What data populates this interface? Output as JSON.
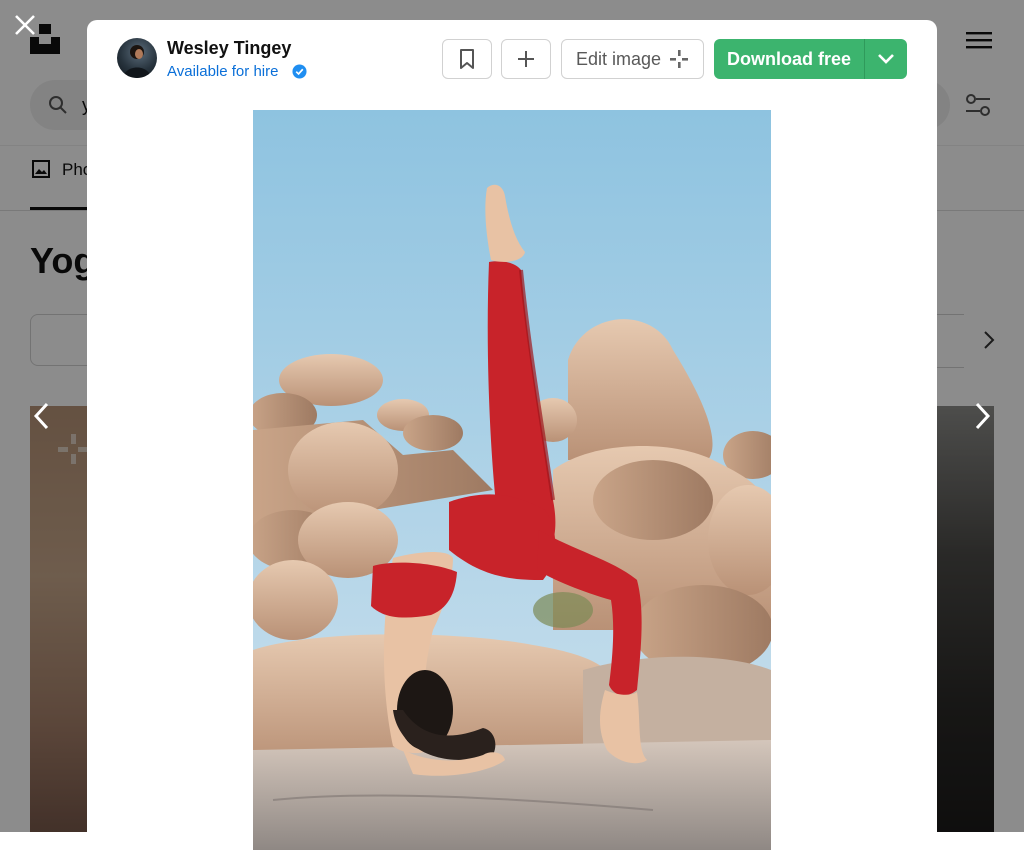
{
  "background": {
    "search_value": "y",
    "tab_photos_label": "Pho",
    "heading": "Yog"
  },
  "author": {
    "name": "Wesley Tingey",
    "hire_status": "Available for hire"
  },
  "actions": {
    "edit_label": "Edit image",
    "download_label": "Download free"
  },
  "colors": {
    "download_green": "#3cb46e",
    "link_blue": "#0a6fd8",
    "outfit_red": "#c8232a",
    "sky_blue": "#8ec3e0"
  },
  "icons": [
    "close-icon",
    "bookmark-icon",
    "plus-icon",
    "edit-sparkle-icon",
    "chevron-down-icon",
    "chevron-left-icon",
    "chevron-right-icon",
    "verified-badge-icon",
    "search-icon",
    "filter-icon",
    "menu-icon",
    "logo-icon",
    "image-icon"
  ]
}
